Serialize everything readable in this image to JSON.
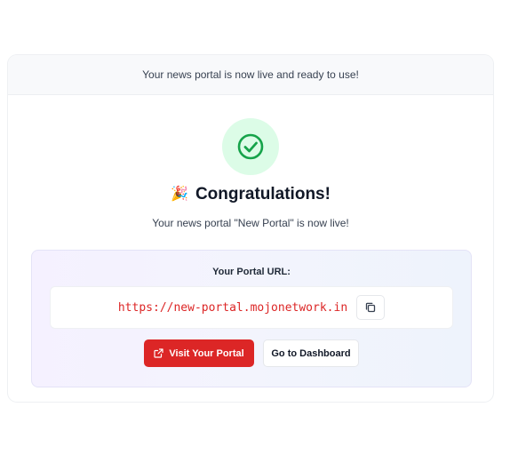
{
  "header": {
    "message": "Your news portal is now live and ready to use!"
  },
  "success": {
    "icon": "check-circle-icon",
    "party_icon": "🎉",
    "title": "Congratulations!",
    "subtitle": "Your news portal \"New Portal\" is now live!"
  },
  "portal": {
    "url_label": "Your Portal URL:",
    "url": "https://new-portal.mojonetwork.in",
    "copy_icon": "copy-icon"
  },
  "actions": {
    "visit_label": "Visit Your Portal",
    "visit_icon": "external-link-icon",
    "dashboard_label": "Go to Dashboard"
  },
  "colors": {
    "accent": "#dc2626",
    "success": "#16a34a",
    "success_bg": "#dcfce7"
  }
}
